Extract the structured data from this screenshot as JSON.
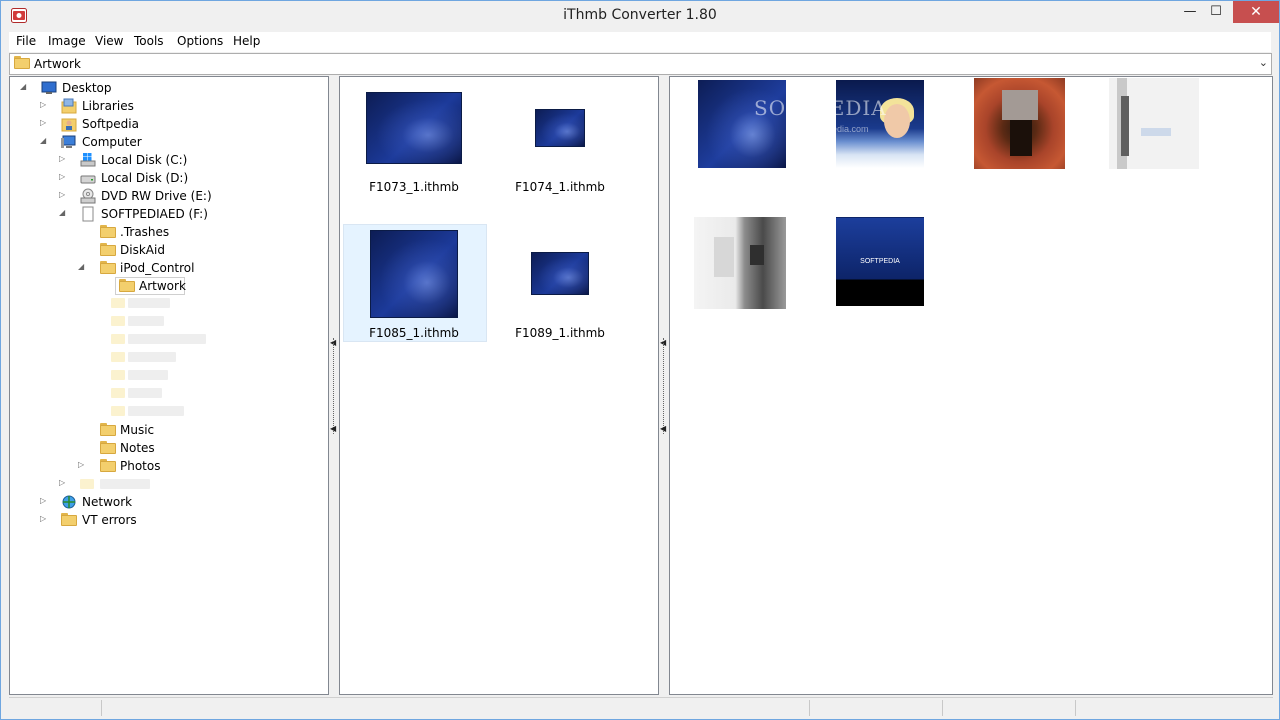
{
  "window": {
    "title": "iThmb Converter 1.80",
    "controls": {
      "minimize": "—",
      "maximize": "☐",
      "close": "✕"
    }
  },
  "menu": [
    "File",
    "Image",
    "View",
    "Tools",
    "Options",
    "Help"
  ],
  "address": {
    "current": "Artwork"
  },
  "tree": {
    "desktop": "Desktop",
    "libraries": "Libraries",
    "softpedia": "Softpedia",
    "computer": "Computer",
    "disk_c": "Local Disk (C:)",
    "disk_d": "Local Disk (D:)",
    "dvd": "DVD RW Drive (E:)",
    "softpediaed": "SOFTPEDIAED (F:)",
    "trashes": ".Trashes",
    "diskaid": "DiskAid",
    "ipod_control": "iPod_Control",
    "artwork": "Artwork",
    "music": "Music",
    "notes": "Notes",
    "photos": "Photos",
    "network": "Network",
    "vt_errors": "VT errors"
  },
  "thumbnails": [
    {
      "name": "F1073_1.ithmb"
    },
    {
      "name": "F1074_1.ithmb"
    },
    {
      "name": "F1085_1.ithmb"
    },
    {
      "name": "F1089_1.ithmb"
    }
  ],
  "preview": {
    "watermark": "SOFTPEDIA",
    "watermark_sub": "www.softpedia.com",
    "logo_text": "SOFTPEDIA"
  },
  "colors": {
    "selection": "#e5f3ff",
    "close_button": "#c74f4f",
    "window_border": "#6fa6e0"
  }
}
